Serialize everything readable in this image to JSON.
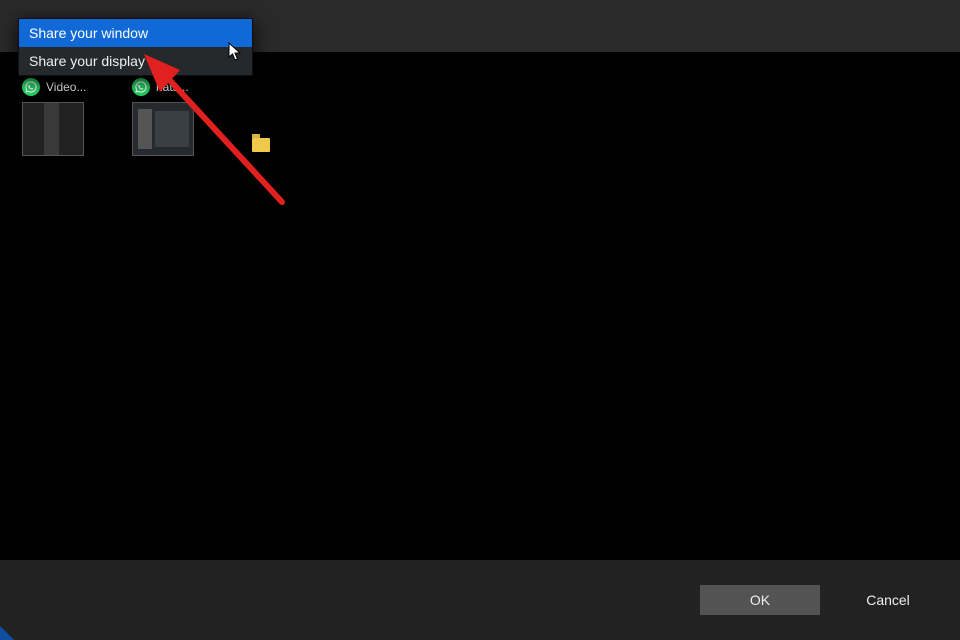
{
  "menu": {
    "items": [
      {
        "label": "Share your window",
        "selected": true
      },
      {
        "label": "Share your display",
        "selected": false
      }
    ]
  },
  "share_targets": {
    "window1": {
      "label": "Video...",
      "icon": "whatsapp-icon"
    },
    "window2": {
      "label": "hats...",
      "icon": "whatsapp-icon"
    }
  },
  "buttons": {
    "ok": "OK",
    "cancel": "Cancel"
  },
  "annotation": {
    "arrow_color": "#e12020",
    "arrow_target": "menu.item.share-your-display"
  }
}
